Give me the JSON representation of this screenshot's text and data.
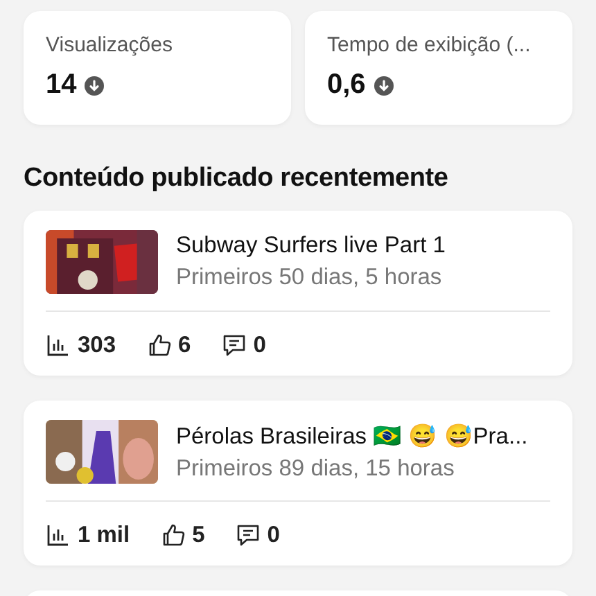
{
  "metrics": [
    {
      "label": "Visualizações",
      "value": "14",
      "falling": true
    },
    {
      "label": "Tempo de exibição (...",
      "value": "0,6",
      "falling": true
    }
  ],
  "section_title": "Conteúdo publicado recentemente",
  "videos": [
    {
      "kind": "picture",
      "title": "Subway Surfers live Part 1",
      "subtitle": "Primeiros 50 dias, 5 horas",
      "views": "303",
      "likes": "6",
      "comments": "0"
    },
    {
      "kind": "picture",
      "title": "Pérolas Brasileiras 🇧🇷 😅 😅Pra...",
      "subtitle": "Primeiros 89 dias, 15 horas",
      "views": "1 mil",
      "likes": "5",
      "comments": "0"
    }
  ]
}
